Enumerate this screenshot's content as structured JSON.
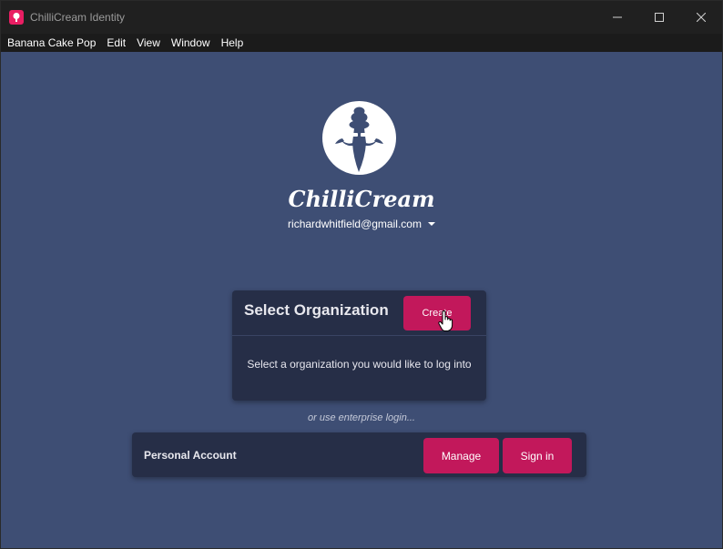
{
  "window": {
    "title": "ChilliCream Identity",
    "icon": "app-icon",
    "controls": [
      "minimize-icon",
      "maximize-icon",
      "close-icon"
    ]
  },
  "menubar": {
    "items": [
      "Banana Cake Pop",
      "Edit",
      "View",
      "Window",
      "Help"
    ]
  },
  "brand": {
    "logo": "chillicream-logo",
    "name": "ChilliCream"
  },
  "account": {
    "email": "richardwhitfield@gmail.com",
    "dropdown_icon": "caret-down-icon"
  },
  "organization_card": {
    "title": "Select Organization",
    "create_label": "Create",
    "message": "Select a organization you would like to log into"
  },
  "enterprise": {
    "text": "or use enterprise login..."
  },
  "personal_account": {
    "label": "Personal Account",
    "manage_label": "Manage",
    "signin_label": "Sign in"
  },
  "colors": {
    "background": "#3e4e74",
    "card": "#262e47",
    "accent": "#c2185b",
    "titlebar": "#202020"
  }
}
